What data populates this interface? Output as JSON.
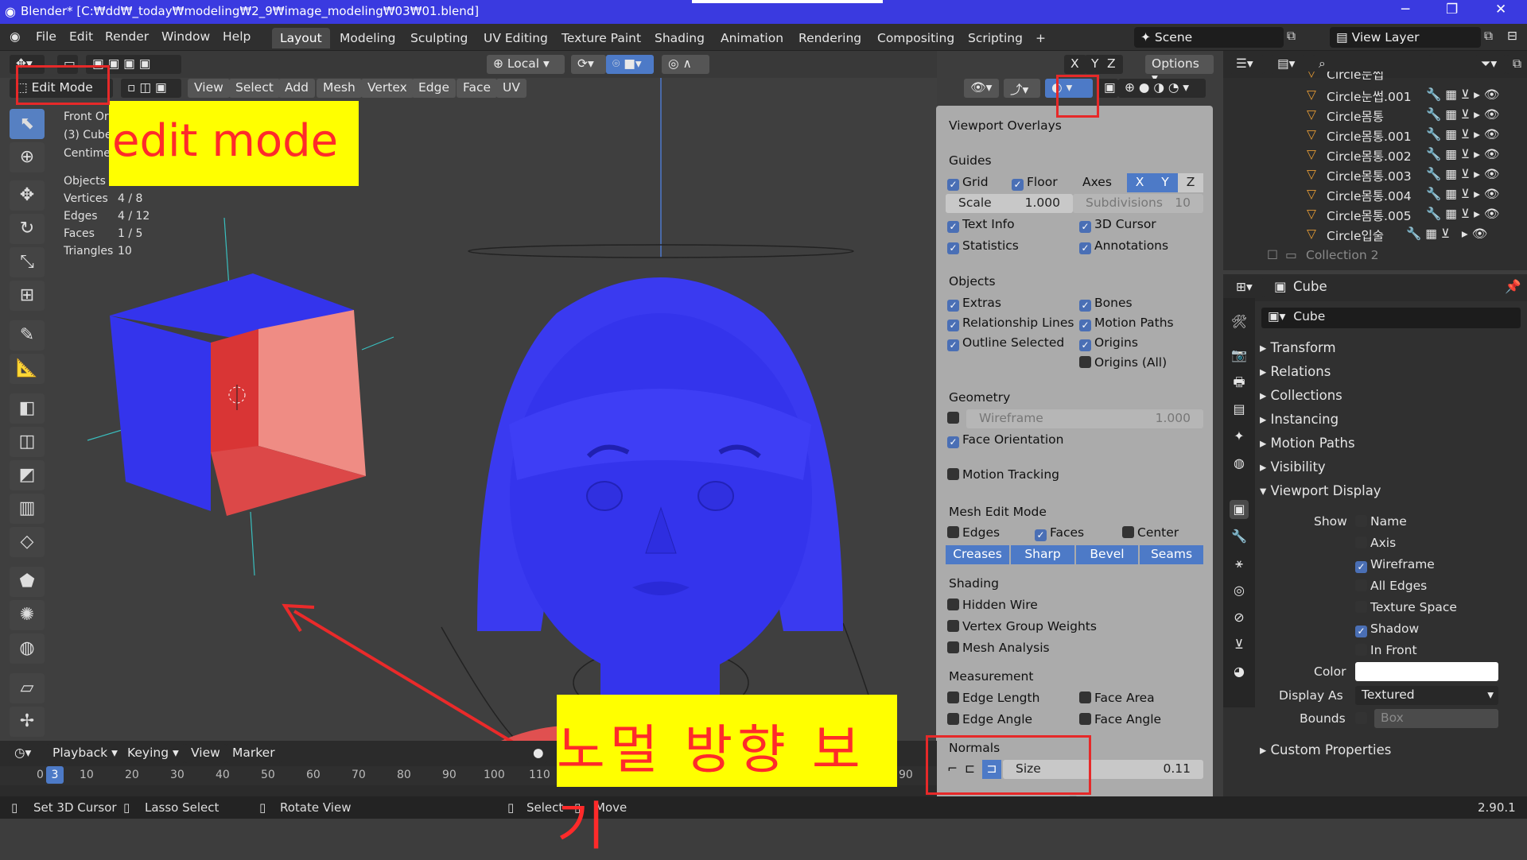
{
  "window": {
    "title": "Blender* [C:₩dd₩_today₩modeling₩2_9₩image_modeling₩03₩01.blend]",
    "minimize": "─",
    "restore": "❐",
    "close": "✕"
  },
  "menu": [
    "File",
    "Edit",
    "Render",
    "Window",
    "Help"
  ],
  "workspaces": [
    "Layout",
    "Modeling",
    "Sculpting",
    "UV Editing",
    "Texture Paint",
    "Shading",
    "Animation",
    "Rendering",
    "Compositing",
    "Scripting"
  ],
  "scene": {
    "scene_label": "Scene",
    "view_layer_label": "View Layer"
  },
  "viewport_header": {
    "mode": "Edit Mode",
    "menus": [
      "View",
      "Select",
      "Add",
      "Mesh",
      "Vertex",
      "Edge",
      "Face",
      "UV"
    ],
    "transform_orientation": "Local",
    "options": "Options",
    "axes": [
      "X",
      "Y",
      "Z"
    ]
  },
  "viewport_info": {
    "view_name": "Front Ortho",
    "object": "(3) Cube",
    "units": "Centimeters",
    "objects_label": "Objects",
    "stats": [
      {
        "label": "Vertices",
        "value": "4 / 8"
      },
      {
        "label": "Edges",
        "value": "4 / 12"
      },
      {
        "label": "Faces",
        "value": "1 / 5"
      },
      {
        "label": "Triangles",
        "value": "10"
      }
    ]
  },
  "overlays": {
    "title": "Viewport Overlays",
    "guides": {
      "heading": "Guides",
      "grid": "Grid",
      "floor": "Floor",
      "axes_label": "Axes",
      "axes": [
        "X",
        "Y",
        "Z"
      ],
      "scale_label": "Scale",
      "scale_value": "1.000",
      "subdiv_label": "Subdivisions",
      "subdiv_value": "10",
      "text_info": "Text Info",
      "cursor": "3D Cursor",
      "statistics": "Statistics",
      "annotations": "Annotations"
    },
    "objects": {
      "heading": "Objects",
      "extras": "Extras",
      "bones": "Bones",
      "relationship": "Relationship Lines",
      "motion_paths": "Motion Paths",
      "outline": "Outline Selected",
      "origins": "Origins",
      "origins_all": "Origins (All)"
    },
    "geometry": {
      "heading": "Geometry",
      "wireframe": "Wireframe",
      "wireframe_value": "1.000",
      "face_orientation": "Face Orientation"
    },
    "motion_tracking": "Motion Tracking",
    "mesh_edit": {
      "heading": "Mesh Edit Mode",
      "edges": "Edges",
      "faces": "Faces",
      "center": "Center",
      "creases": "Creases",
      "sharp": "Sharp",
      "bevel": "Bevel",
      "seams": "Seams"
    },
    "shading": {
      "heading": "Shading",
      "hidden_wire": "Hidden Wire",
      "vgroup": "Vertex Group Weights",
      "mesh_analysis": "Mesh Analysis"
    },
    "measurement": {
      "heading": "Measurement",
      "edge_length": "Edge Length",
      "face_area": "Face Area",
      "edge_angle": "Edge Angle",
      "face_angle": "Face Angle"
    },
    "normals": {
      "heading": "Normals",
      "size_label": "Size",
      "size_value": "0.11"
    }
  },
  "outliner": {
    "items": [
      "Circle눈썹",
      "Circle눈썹.001",
      "Circle몸통",
      "Circle몸통.001",
      "Circle몸통.002",
      "Circle몸통.003",
      "Circle몸통.004",
      "Circle몸통.005",
      "Circle입술"
    ],
    "collection": "Collection 2"
  },
  "properties": {
    "object_name": "Cube",
    "data_name": "Cube",
    "panels": [
      "Transform",
      "Relations",
      "Collections",
      "Instancing",
      "Motion Paths",
      "Visibility",
      "Viewport Display"
    ],
    "show_label": "Show",
    "show_items": [
      {
        "label": "Name",
        "checked": false
      },
      {
        "label": "Axis",
        "checked": false
      },
      {
        "label": "Wireframe",
        "checked": true
      },
      {
        "label": "All Edges",
        "checked": false
      },
      {
        "label": "Texture Space",
        "checked": false
      },
      {
        "label": "Shadow",
        "checked": true
      },
      {
        "label": "In Front",
        "checked": false
      }
    ],
    "color_label": "Color",
    "display_as_label": "Display As",
    "display_as_value": "Textured",
    "bounds_label": "Bounds",
    "bounds_value": "Box",
    "custom_props": "Custom Properties"
  },
  "timeline": {
    "playback": "Playback",
    "keying": "Keying",
    "view": "View",
    "marker": "Marker",
    "frame": "3",
    "ticks": [
      "0",
      "10",
      "20",
      "30",
      "40",
      "50",
      "60",
      "70",
      "80",
      "90",
      "100",
      "110"
    ],
    "end_tick": "90"
  },
  "statusbar": {
    "set_cursor": "Set 3D Cursor",
    "lasso": "Lasso Select",
    "rotate": "Rotate View",
    "select": "Select",
    "move": "Move",
    "version": "2.90.1"
  },
  "annotations": {
    "edit_mode": "edit mode",
    "normals_view": "노멀 방향 보기"
  }
}
